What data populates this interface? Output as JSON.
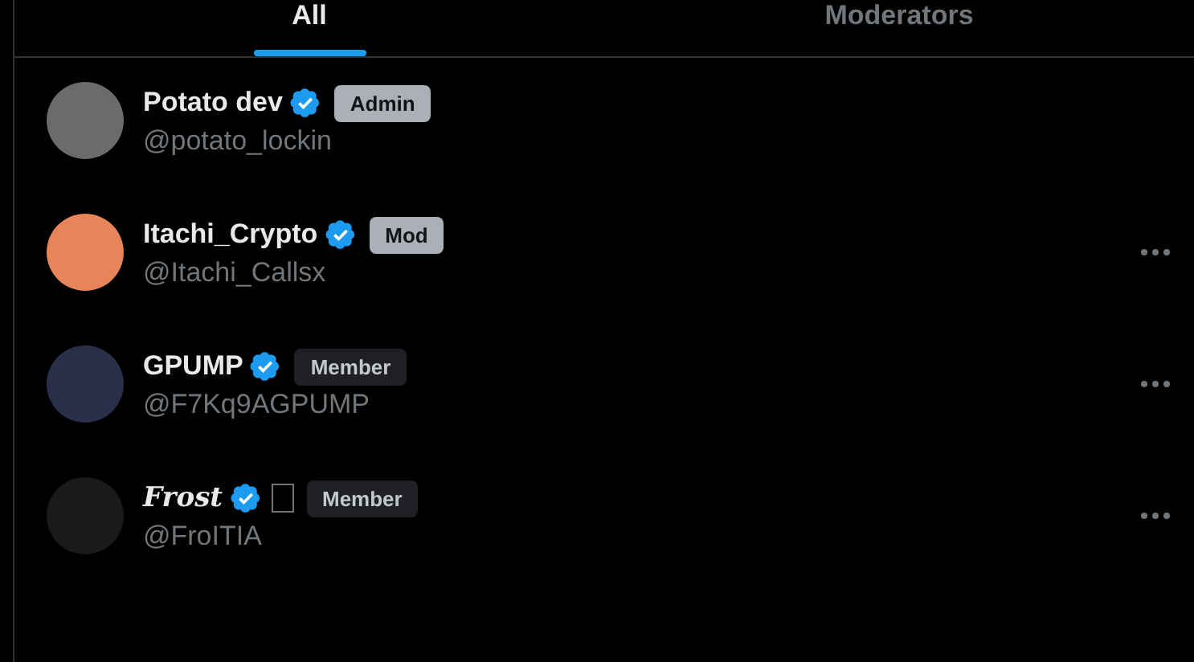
{
  "tabs": [
    {
      "label": "All",
      "selected": true
    },
    {
      "label": "Moderators",
      "selected": false
    }
  ],
  "members": [
    {
      "name": "Potato dev",
      "verified": true,
      "stylized": false,
      "unknown_glyph": false,
      "badge": {
        "label": "Admin",
        "kind": "staff"
      },
      "handle": "@potato_lockin",
      "menu": false
    },
    {
      "name": "Itachi_Crypto",
      "verified": true,
      "stylized": false,
      "unknown_glyph": false,
      "badge": {
        "label": "Mod",
        "kind": "staff"
      },
      "handle": "@Itachi_Callsx",
      "menu": true
    },
    {
      "name": "GPUMP",
      "verified": true,
      "stylized": false,
      "unknown_glyph": false,
      "badge": {
        "label": "Member",
        "kind": "member"
      },
      "handle": "@F7Kq9AGPUMP",
      "menu": true
    },
    {
      "name": "Frost",
      "verified": true,
      "stylized": true,
      "unknown_glyph": true,
      "badge": {
        "label": "Member",
        "kind": "member"
      },
      "handle": "@FroITIA",
      "menu": true
    }
  ]
}
